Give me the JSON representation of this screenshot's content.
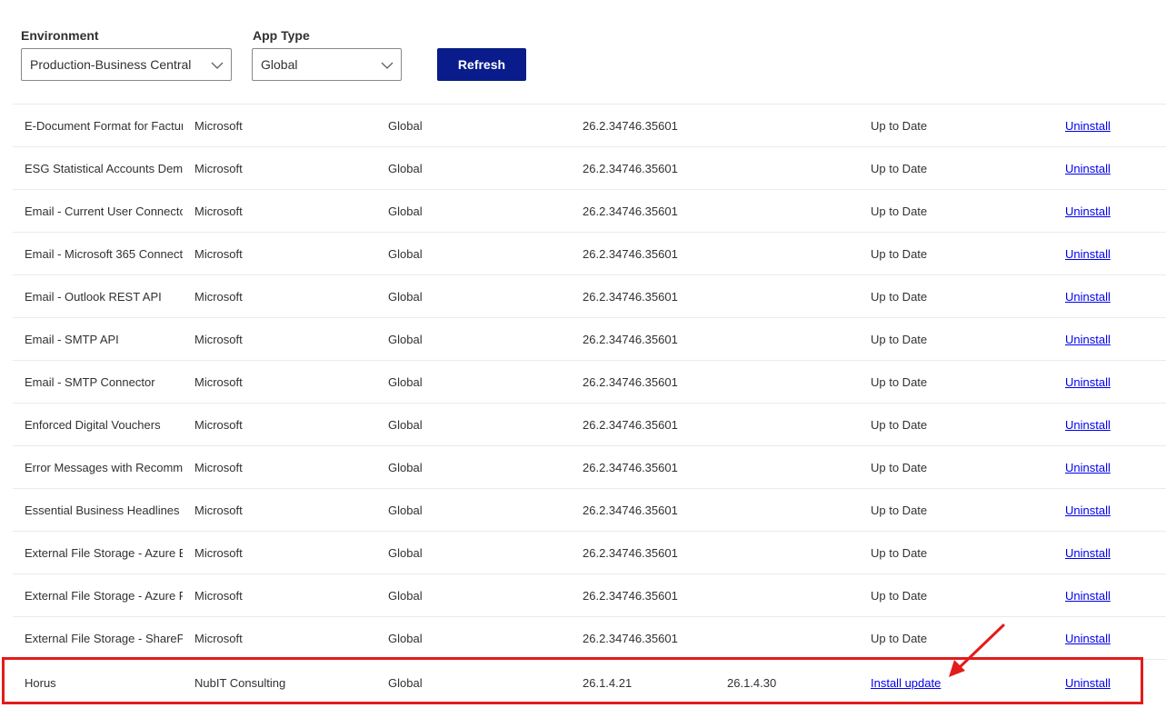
{
  "filters": {
    "environment_label": "Environment",
    "environment_value": "Production-Business Central",
    "app_type_label": "App Type",
    "app_type_value": "Global",
    "refresh_label": "Refresh"
  },
  "rows": [
    {
      "name": "E-Document Format for Factur",
      "publisher": "Microsoft",
      "type": "Global",
      "version": "26.2.34746.35601",
      "available": "",
      "status": "Up to Date",
      "action": "Uninstall"
    },
    {
      "name": "ESG Statistical Accounts Demo",
      "publisher": "Microsoft",
      "type": "Global",
      "version": "26.2.34746.35601",
      "available": "",
      "status": "Up to Date",
      "action": "Uninstall"
    },
    {
      "name": "Email - Current User Connecto",
      "publisher": "Microsoft",
      "type": "Global",
      "version": "26.2.34746.35601",
      "available": "",
      "status": "Up to Date",
      "action": "Uninstall"
    },
    {
      "name": "Email - Microsoft 365 Connect",
      "publisher": "Microsoft",
      "type": "Global",
      "version": "26.2.34746.35601",
      "available": "",
      "status": "Up to Date",
      "action": "Uninstall"
    },
    {
      "name": "Email - Outlook REST API",
      "publisher": "Microsoft",
      "type": "Global",
      "version": "26.2.34746.35601",
      "available": "",
      "status": "Up to Date",
      "action": "Uninstall"
    },
    {
      "name": "Email - SMTP API",
      "publisher": "Microsoft",
      "type": "Global",
      "version": "26.2.34746.35601",
      "available": "",
      "status": "Up to Date",
      "action": "Uninstall"
    },
    {
      "name": "Email - SMTP Connector",
      "publisher": "Microsoft",
      "type": "Global",
      "version": "26.2.34746.35601",
      "available": "",
      "status": "Up to Date",
      "action": "Uninstall"
    },
    {
      "name": "Enforced Digital Vouchers",
      "publisher": "Microsoft",
      "type": "Global",
      "version": "26.2.34746.35601",
      "available": "",
      "status": "Up to Date",
      "action": "Uninstall"
    },
    {
      "name": "Error Messages with Recomme",
      "publisher": "Microsoft",
      "type": "Global",
      "version": "26.2.34746.35601",
      "available": "",
      "status": "Up to Date",
      "action": "Uninstall"
    },
    {
      "name": "Essential Business Headlines",
      "publisher": "Microsoft",
      "type": "Global",
      "version": "26.2.34746.35601",
      "available": "",
      "status": "Up to Date",
      "action": "Uninstall"
    },
    {
      "name": "External File Storage - Azure B",
      "publisher": "Microsoft",
      "type": "Global",
      "version": "26.2.34746.35601",
      "available": "",
      "status": "Up to Date",
      "action": "Uninstall"
    },
    {
      "name": "External File Storage - Azure F",
      "publisher": "Microsoft",
      "type": "Global",
      "version": "26.2.34746.35601",
      "available": "",
      "status": "Up to Date",
      "action": "Uninstall"
    },
    {
      "name": "External File Storage - SharePo",
      "publisher": "Microsoft",
      "type": "Global",
      "version": "26.2.34746.35601",
      "available": "",
      "status": "Up to Date",
      "action": "Uninstall"
    },
    {
      "name": "Horus",
      "publisher": "NubIT Consulting",
      "type": "Global",
      "version": "26.1.4.21",
      "available": "26.1.4.30",
      "status": "Install update",
      "status_is_link": true,
      "action": "Uninstall"
    }
  ],
  "annotation": {
    "highlight_color": "#e31b1b",
    "highlighted_row_index": 13
  },
  "colors": {
    "primary_button": "#0a1c8c",
    "link": "#0000ee"
  }
}
